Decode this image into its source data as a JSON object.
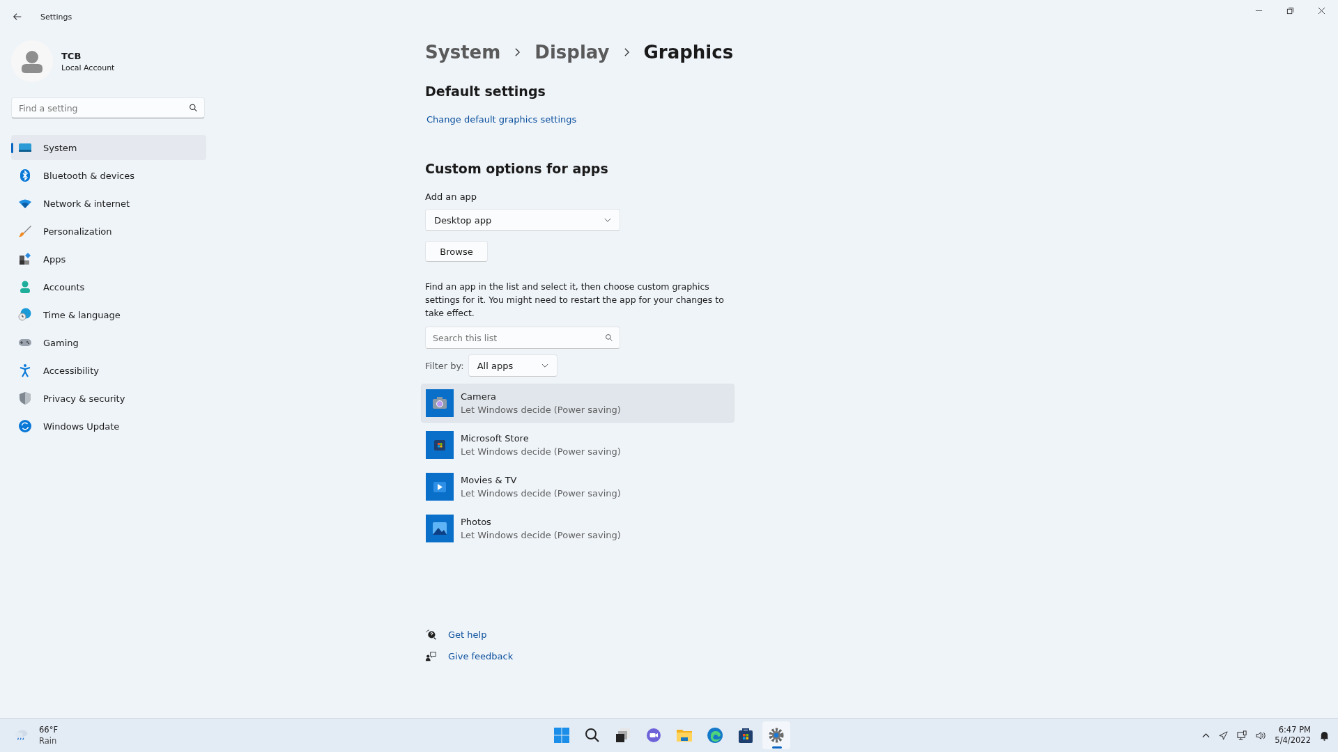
{
  "window": {
    "title": "Settings"
  },
  "account": {
    "name": "TCB",
    "type": "Local Account"
  },
  "search": {
    "placeholder": "Find a setting"
  },
  "sidebar": {
    "items": [
      {
        "label": "System",
        "selected": true
      },
      {
        "label": "Bluetooth & devices",
        "selected": false
      },
      {
        "label": "Network & internet",
        "selected": false
      },
      {
        "label": "Personalization",
        "selected": false
      },
      {
        "label": "Apps",
        "selected": false
      },
      {
        "label": "Accounts",
        "selected": false
      },
      {
        "label": "Time & language",
        "selected": false
      },
      {
        "label": "Gaming",
        "selected": false
      },
      {
        "label": "Accessibility",
        "selected": false
      },
      {
        "label": "Privacy & security",
        "selected": false
      },
      {
        "label": "Windows Update",
        "selected": false
      }
    ]
  },
  "breadcrumb": [
    "System",
    "Display",
    "Graphics"
  ],
  "default_settings": {
    "heading": "Default settings",
    "link": "Change default graphics settings"
  },
  "custom_options": {
    "heading": "Custom options for apps",
    "add_label": "Add an app",
    "app_type": "Desktop app",
    "browse": "Browse",
    "description": "Find an app in the list and select it, then choose custom graphics settings for it. You might need to restart the app for your changes to take effect.",
    "search_placeholder": "Search this list",
    "filter_label": "Filter by:",
    "filter_value": "All apps"
  },
  "apps": [
    {
      "name": "Camera",
      "setting": "Let Windows decide (Power saving)",
      "selected": true
    },
    {
      "name": "Microsoft Store",
      "setting": "Let Windows decide (Power saving)",
      "selected": false
    },
    {
      "name": "Movies & TV",
      "setting": "Let Windows decide (Power saving)",
      "selected": false
    },
    {
      "name": "Photos",
      "setting": "Let Windows decide (Power saving)",
      "selected": false
    }
  ],
  "help_links": [
    "Get help",
    "Give feedback"
  ],
  "taskbar": {
    "weather": {
      "temp": "66°F",
      "condition": "Rain"
    },
    "time": "6:47 PM",
    "date": "5/4/2022"
  }
}
